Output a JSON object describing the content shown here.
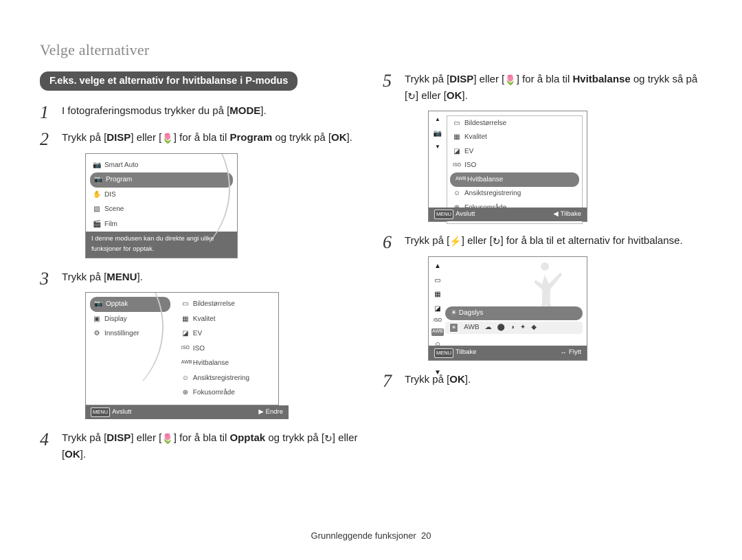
{
  "page_title": "Velge alternativer",
  "pill_label": "F.eks. velge et alternativ for hvitbalanse i P-modus",
  "steps_left": {
    "s1": "I fotograferingsmodus trykker du på [",
    "s1_key": "MODE",
    "s1_end": "].",
    "s2a": "Trykk på [",
    "s2_key1": "DISP",
    "s2b": "] eller [",
    "s2_macro": "🌷",
    "s2c": "] for å bla til ",
    "s2_bold": "Program",
    "s2d": " og trykk på [",
    "s2_ok": "OK",
    "s2e": "].",
    "s3": "Trykk på [",
    "s3_key": "MENU",
    "s3_end": "].",
    "s4a": "Trykk på [",
    "s4_key1": "DISP",
    "s4b": "] eller [",
    "s4_macro": "🌷",
    "s4c": "] for å bla til ",
    "s4_bold": "Opptak",
    "s4d": " og trykk på [",
    "s4_timer": "↻",
    "s4e": "] eller [",
    "s4_ok": "OK",
    "s4f": "]."
  },
  "steps_right": {
    "s5a": "Trykk på [",
    "s5_key1": "DISP",
    "s5b": "] eller [",
    "s5_macro": "🌷",
    "s5c": "] for å bla til ",
    "s5_bold": "Hvitbalanse",
    "s5d": " og trykk så på [",
    "s5_timer": "↻",
    "s5e": "] eller [",
    "s5_ok": "OK",
    "s5f": "].",
    "s6a": "Trykk på [",
    "s6_flash": "⚡",
    "s6b": "] eller [",
    "s6_timer": "↻",
    "s6c": "] for å bla til et alternativ for hvitbalanse.",
    "s7a": "Trykk på [",
    "s7_ok": "OK",
    "s7b": "]."
  },
  "lcd1": {
    "items": [
      {
        "icon": "📷",
        "label": "Smart Auto"
      },
      {
        "icon": "📷",
        "label": "Program"
      },
      {
        "icon": "✋",
        "label": "DIS"
      },
      {
        "icon": "▧",
        "label": "Scene"
      },
      {
        "icon": "🎬",
        "label": "Film"
      }
    ],
    "selected_index": 1,
    "caption": "I denne modusen kan du direkte angi ulike funksjoner for opptak."
  },
  "lcd3": {
    "left": [
      {
        "icon": "📷",
        "label": "Opptak"
      },
      {
        "icon": "▣",
        "label": "Display"
      },
      {
        "icon": "⚙",
        "label": "Innstillinger"
      }
    ],
    "left_selected": 0,
    "right": [
      {
        "icon": "▭",
        "label": "Bildestørrelse"
      },
      {
        "icon": "▦",
        "label": "Kvalitet"
      },
      {
        "icon": "◪",
        "label": "EV"
      },
      {
        "icon": "ISO",
        "label": "ISO"
      },
      {
        "icon": "AWB",
        "label": "Hvitbalanse"
      },
      {
        "icon": "☺",
        "label": "Ansiktsregistrering"
      },
      {
        "icon": "⊕",
        "label": "Fokusområde"
      }
    ],
    "footer_left_btn": "MENU",
    "footer_left": "Avslutt",
    "footer_right_sym": "▶",
    "footer_right": "Endre"
  },
  "lcd5": {
    "items": [
      {
        "icon": "▭",
        "label": "Bildestørrelse"
      },
      {
        "icon": "▦",
        "label": "Kvalitet"
      },
      {
        "icon": "◪",
        "label": "EV"
      },
      {
        "icon": "ISO",
        "label": "ISO"
      },
      {
        "icon": "AWB",
        "label": "Hvitbalanse"
      },
      {
        "icon": "☺",
        "label": "Ansiktsregistrering"
      },
      {
        "icon": "⊕",
        "label": "Fokusområde"
      }
    ],
    "selected_index": 4,
    "side_main": "📷",
    "footer_left_btn": "MENU",
    "footer_left": "Avslutt",
    "footer_right_sym": "◀",
    "footer_right": "Tilbake"
  },
  "lcd6": {
    "sel_label": "Dagslys",
    "sel_icon": "☀",
    "footer_left_btn": "MENU",
    "footer_left": "Tilbake",
    "footer_right_sym": "↔",
    "footer_right": "Flytt",
    "icons": [
      "☀",
      "AWB",
      "☁",
      "⬤",
      "◑",
      "✦",
      "◆"
    ]
  },
  "footer_text": "Grunnleggende funksjoner",
  "footer_page": "20"
}
